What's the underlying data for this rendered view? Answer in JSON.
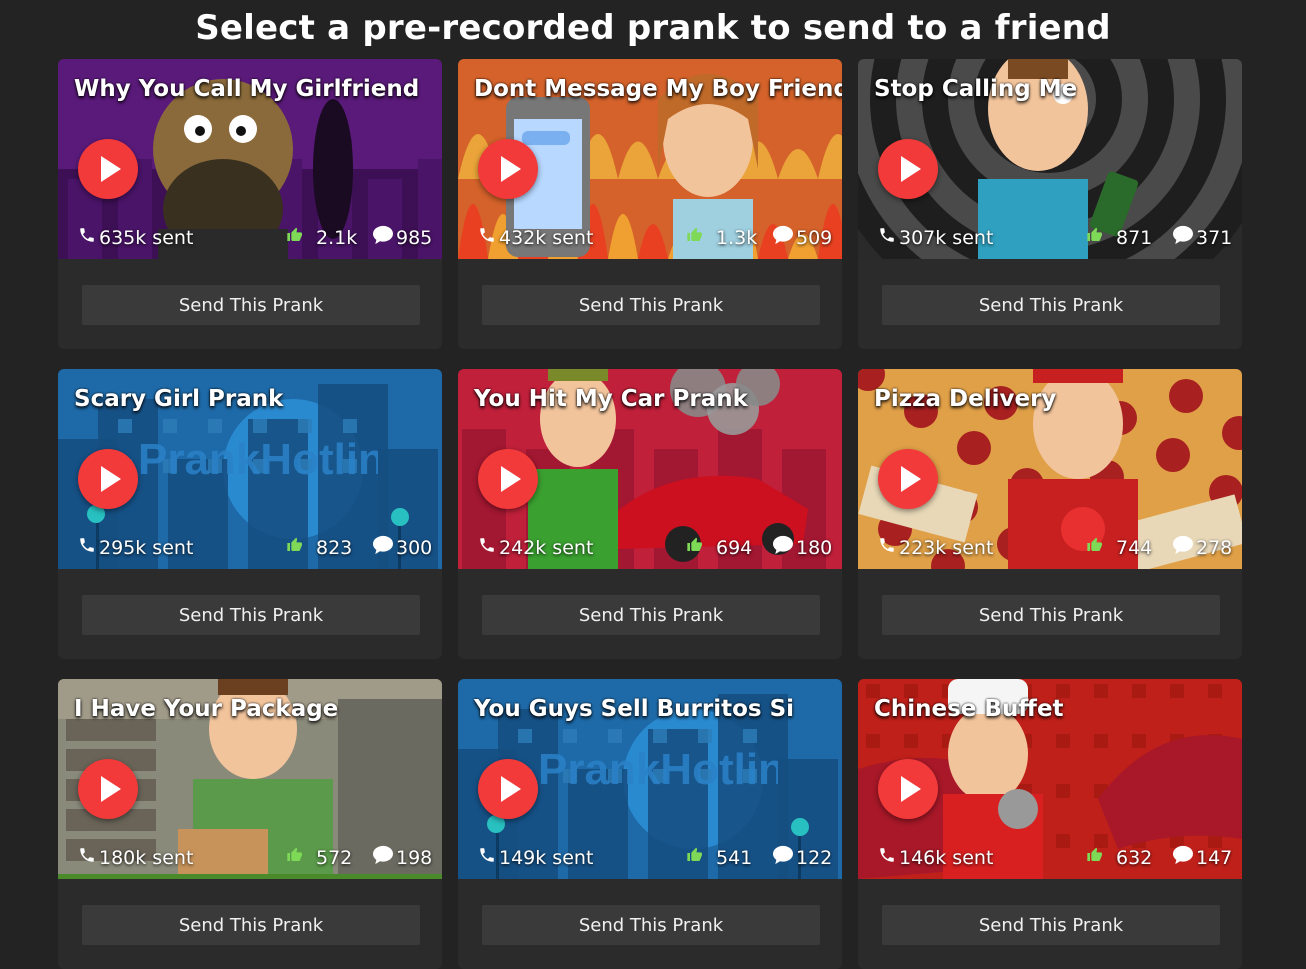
{
  "header": {
    "title": "Select a pre-recorded prank to send to a friend"
  },
  "cards": [
    {
      "title": "Why You Call My Girlfriend",
      "sent": "635k sent",
      "likes": "2.1k",
      "comments": "985",
      "button": "Send This Prank",
      "theme": "purple"
    },
    {
      "title": "Dont Message My Boy Friend",
      "sent": "432k sent",
      "likes": "1.3k",
      "comments": "509",
      "button": "Send This Prank",
      "theme": "fire"
    },
    {
      "title": "Stop Calling Me",
      "sent": "307k sent",
      "likes": "871",
      "comments": "371",
      "button": "Send This Prank",
      "theme": "spiral"
    },
    {
      "title": "Scary Girl Prank",
      "sent": "295k sent",
      "likes": "823",
      "comments": "300",
      "button": "Send This Prank",
      "theme": "city"
    },
    {
      "title": "You Hit My Car Prank",
      "sent": "242k sent",
      "likes": "694",
      "comments": "180",
      "button": "Send This Prank",
      "theme": "red"
    },
    {
      "title": "Pizza Delivery",
      "sent": "223k sent",
      "likes": "744",
      "comments": "278",
      "button": "Send This Prank",
      "theme": "pizza"
    },
    {
      "title": "I Have Your Package",
      "sent": "180k sent",
      "likes": "572",
      "comments": "198",
      "button": "Send This Prank",
      "theme": "package"
    },
    {
      "title": "You Guys Sell Burritos Si",
      "sent": "149k sent",
      "likes": "541",
      "comments": "122",
      "button": "Send This Prank",
      "theme": "city"
    },
    {
      "title": "Chinese Buffet",
      "sent": "146k sent",
      "likes": "632",
      "comments": "147",
      "button": "Send This Prank",
      "theme": "dragon"
    }
  ],
  "watermark": "PrankHotline",
  "icons": {
    "play": "play-icon",
    "phone": "phone-icon",
    "like": "thumbs-up-icon",
    "comment": "speech-bubble-icon"
  },
  "colors": {
    "background": "#232323",
    "card": "#2b2b2b",
    "button": "#3a3a3a",
    "play": "#f23a3a",
    "like": "#7ed957"
  }
}
